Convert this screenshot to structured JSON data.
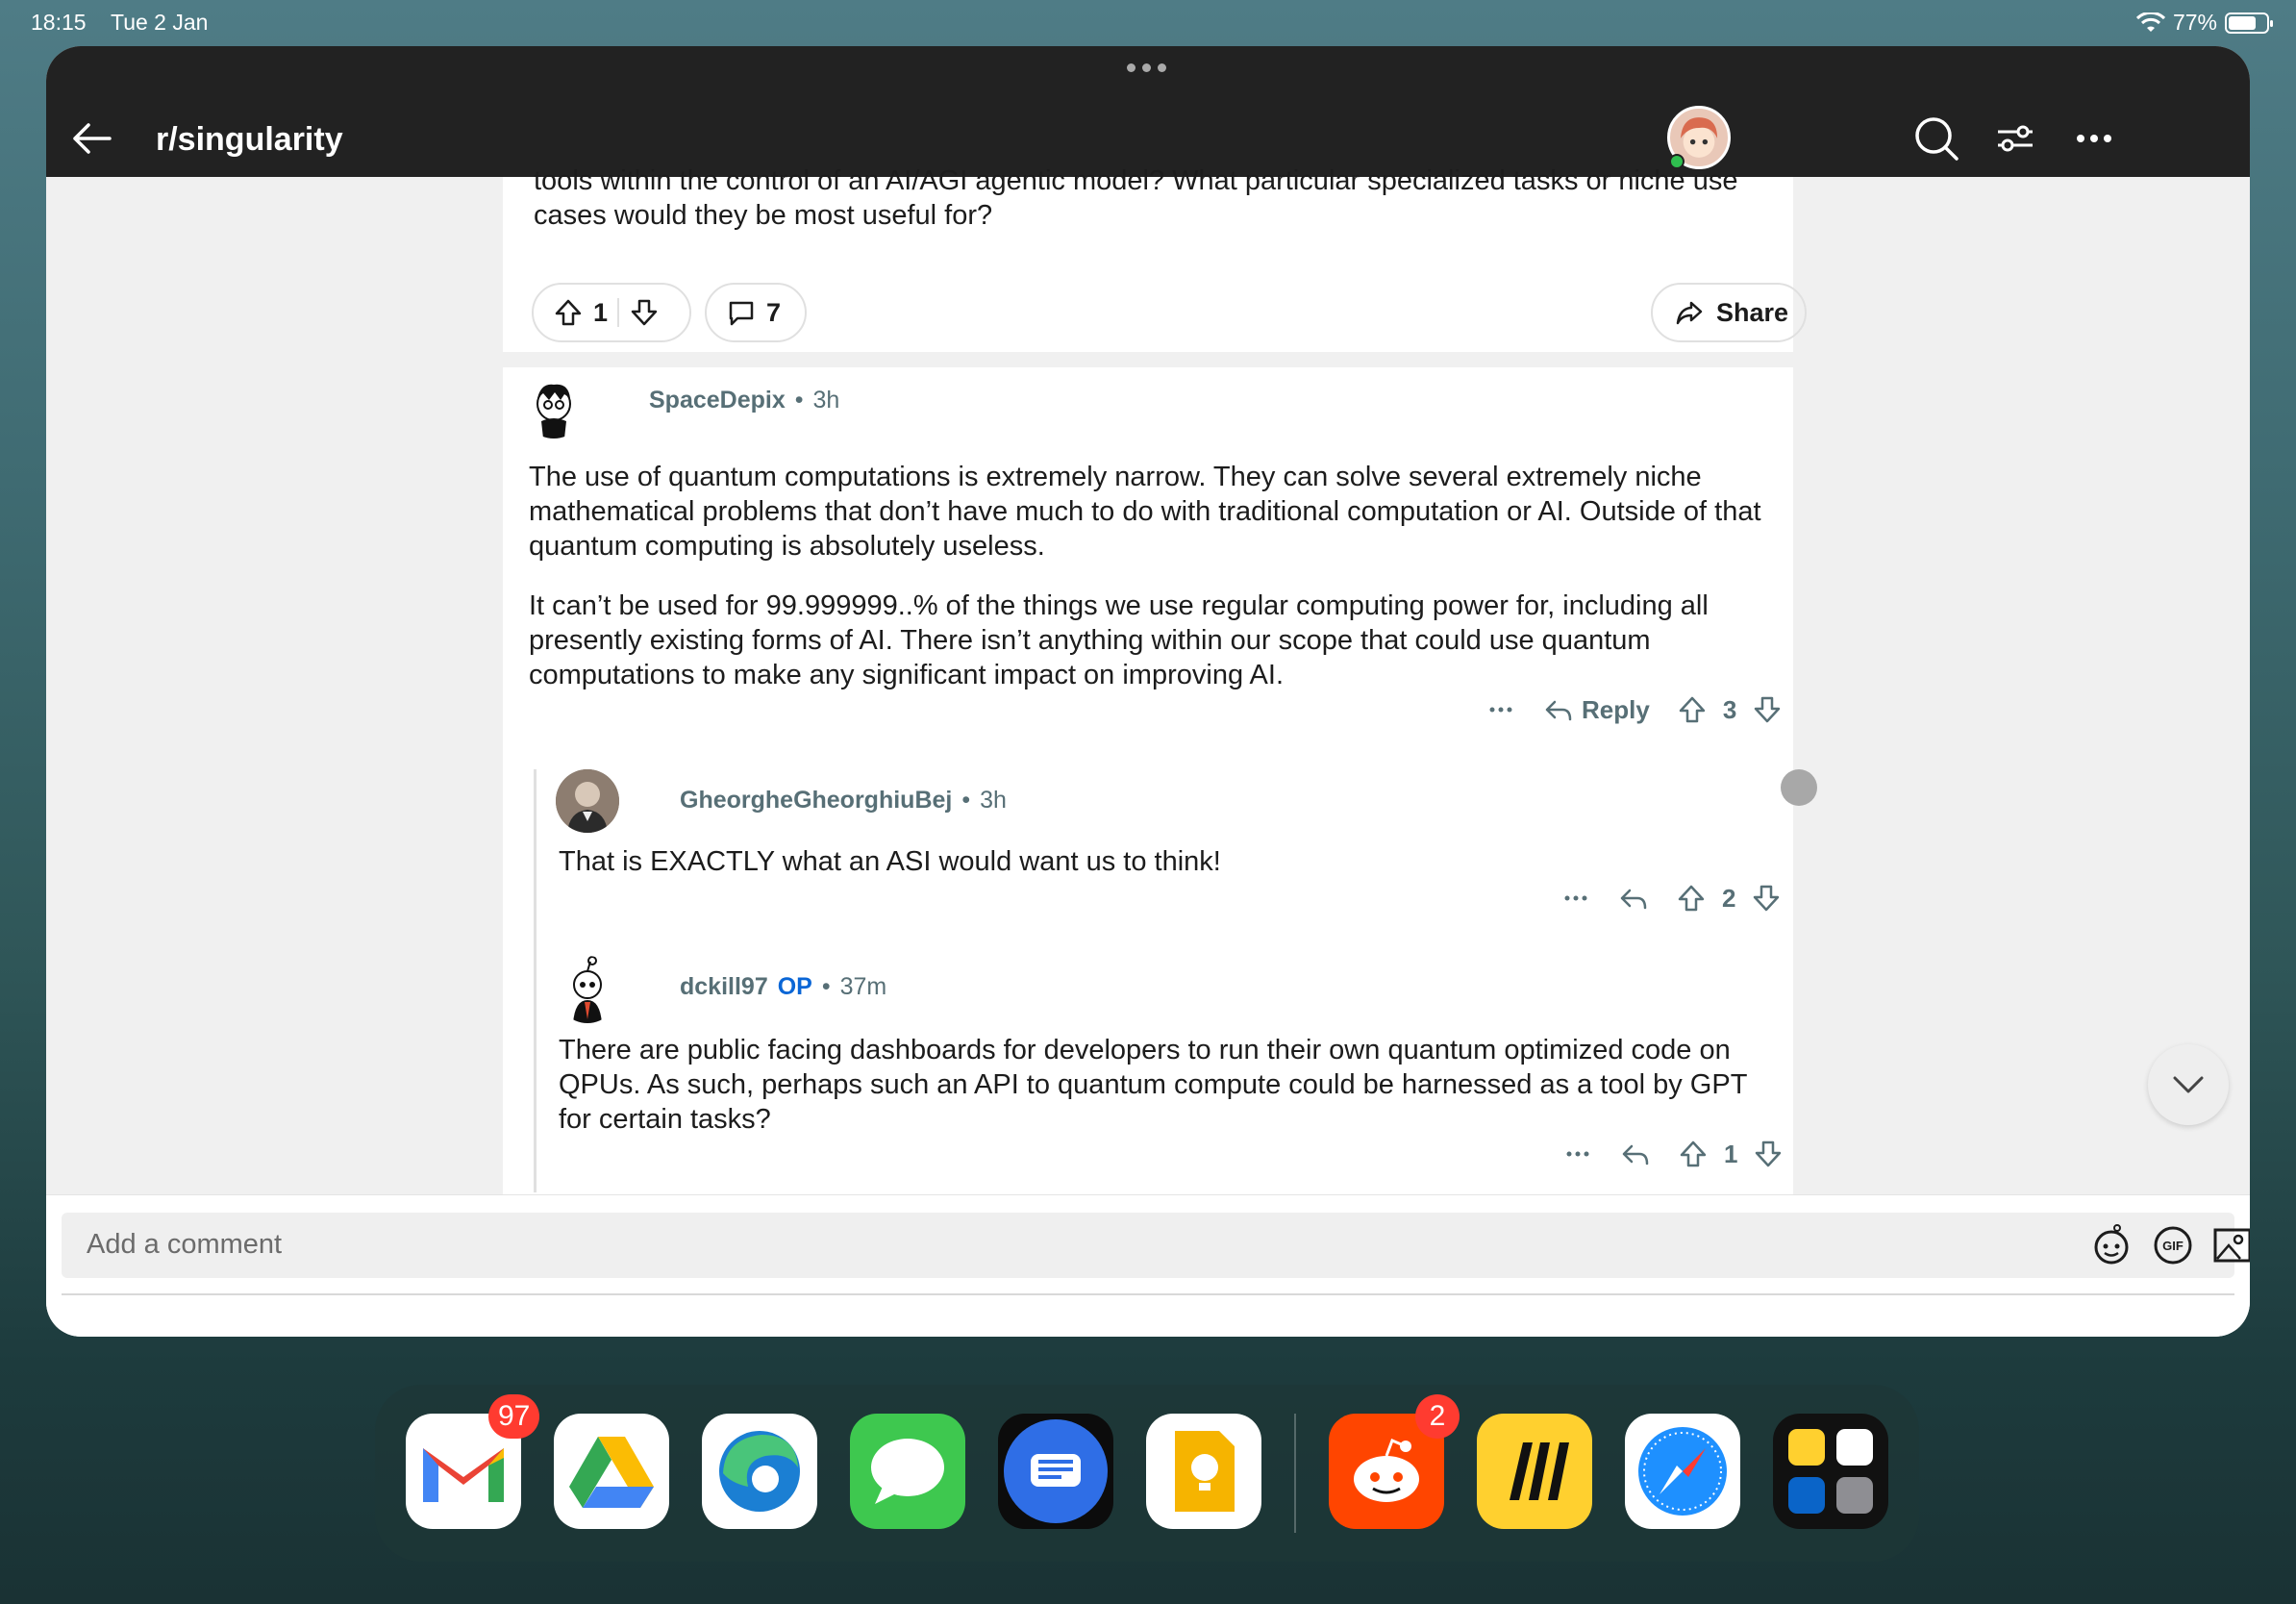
{
  "status_bar": {
    "time": "18:15",
    "date": "Tue 2 Jan",
    "battery": "77%"
  },
  "header": {
    "subreddit": "r/singularity",
    "icons": [
      "back-arrow-icon",
      "search-icon",
      "filter-icon",
      "more-icon",
      "avatar"
    ]
  },
  "post": {
    "text_tail": "tools within the control of an AI/AGI agentic model? What particular specialized tasks or niche use cases would they be most useful for?",
    "upvotes": "1",
    "comments": "7",
    "share_label": "Share"
  },
  "comments": [
    {
      "author": "SpaceDepix",
      "time": "3h",
      "paragraphs": [
        "The use of quantum computations is extremely narrow. They can solve several extremely niche mathematical problems that don’t have much to do with traditional computation or AI. Outside of that quantum computing is absolutely useless.",
        "It can’t be used for 99.999999..% of the things we use regular computing power for, including all presently existing forms of AI. There isn’t anything within our scope that could use quantum computations to make any significant impact on improving AI."
      ],
      "reply_label": "Reply",
      "score": "3"
    },
    {
      "author": "GheorgheGheorghiuBej",
      "time": "3h",
      "text": "That is EXACTLY what an ASI would want us to think!",
      "score": "2"
    },
    {
      "author": "dckill97",
      "flair": "OP",
      "time": "37m",
      "text": "There are public facing dashboards for developers to run their own quantum optimized code on QPUs. As such, perhaps such an API to quantum compute could be harnessed as a tool by GPT for certain tasks?",
      "score": "1"
    }
  ],
  "composer": {
    "placeholder": "Add a comment",
    "icons": [
      "snoo-emoji-icon",
      "gif-icon",
      "image-icon"
    ]
  },
  "dock": {
    "apps": [
      "Gmail",
      "Google Drive",
      "Edge",
      "Messages",
      "Beeper",
      "Google Keep",
      "Reddit",
      "Miro",
      "Safari",
      "App Library"
    ],
    "gmail_badge": "97",
    "reddit_badge": "2"
  }
}
